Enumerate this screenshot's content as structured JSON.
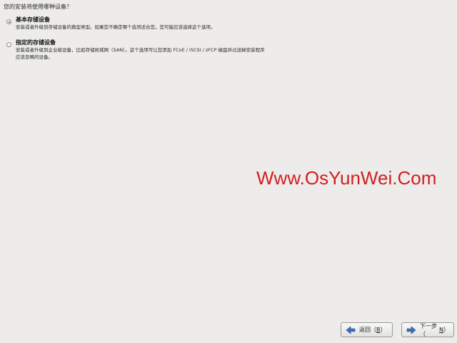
{
  "question": "您的安装将使用哪种设备？",
  "options": [
    {
      "title": "基本存储设备",
      "description": "安装或者升级到存储设备的典型类型。如果您不确定哪个选项适合您，您可能应该选择这个选项。",
      "selected": true
    },
    {
      "title": "指定的存储设备",
      "description": "安装或者升级到企业级设备，比如存储局域网（SAN）。这个选项可让您添加 FCoE / iSCSI / zFCP 磁盘并过滤掉安装程序\n应该忽略的设备。",
      "selected": false
    }
  ],
  "watermark": "Www.OsYunWei.Com",
  "buttons": {
    "back": {
      "label": "返回（",
      "mnemonic": "B",
      "close": "）",
      "icon": "arrow-left-icon"
    },
    "next": {
      "label": "下一步（",
      "mnemonic": "N",
      "close": "）",
      "icon": "arrow-right-icon"
    }
  },
  "colors": {
    "background": "#edeceb",
    "watermark": "#d21f1f",
    "arrow_back": "#3d6fb4",
    "arrow_next": "#3d6fb4"
  }
}
